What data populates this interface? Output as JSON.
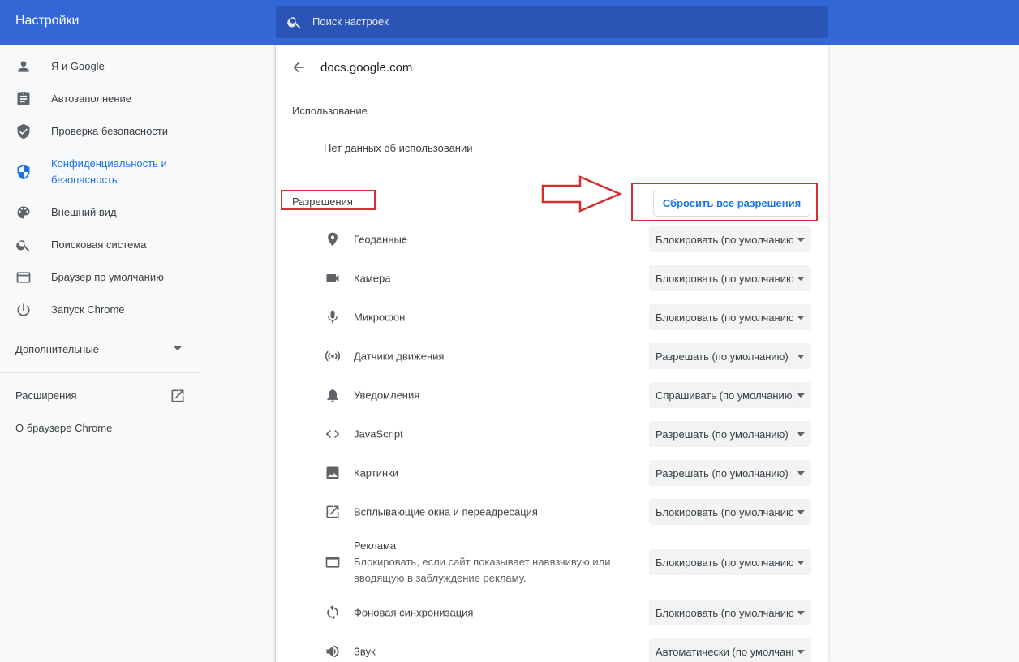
{
  "header": {
    "title": "Настройки",
    "search_placeholder": "Поиск настроек"
  },
  "sidebar": {
    "items": [
      {
        "label": "Я и Google",
        "icon": "person-icon"
      },
      {
        "label": "Автозаполнение",
        "icon": "clipboard-icon"
      },
      {
        "label": "Проверка безопасности",
        "icon": "shield-check-icon"
      },
      {
        "label": "Конфиденциальность и безопасность",
        "icon": "privacy-shield-icon",
        "active": true
      },
      {
        "label": "Внешний вид",
        "icon": "palette-icon"
      },
      {
        "label": "Поисковая система",
        "icon": "search-icon"
      },
      {
        "label": "Браузер по умолчанию",
        "icon": "browser-window-icon"
      },
      {
        "label": "Запуск Chrome",
        "icon": "power-icon"
      }
    ],
    "advanced_label": "Дополнительные",
    "extensions_label": "Расширения",
    "about_label": "О браузере Chrome"
  },
  "main": {
    "site": "docs.google.com",
    "usage_heading": "Использование",
    "usage_text": "Нет данных об использовании",
    "permissions_heading": "Разрешения",
    "reset_button": "Сбросить все разрешения",
    "permissions": [
      {
        "label": "Геоданные",
        "value": "Блокировать (по умолчанию)",
        "icon": "location-pin-icon"
      },
      {
        "label": "Камера",
        "value": "Блокировать (по умолчанию)",
        "icon": "camera-icon"
      },
      {
        "label": "Микрофон",
        "value": "Блокировать (по умолчанию)",
        "icon": "microphone-icon"
      },
      {
        "label": "Датчики движения",
        "value": "Разрешать (по умолчанию)",
        "icon": "sensors-icon"
      },
      {
        "label": "Уведомления",
        "value": "Спрашивать (по умолчанию)",
        "icon": "bell-icon"
      },
      {
        "label": "JavaScript",
        "value": "Разрешать (по умолчанию)",
        "icon": "code-icon"
      },
      {
        "label": "Картинки",
        "value": "Разрешать (по умолчанию)",
        "icon": "image-icon"
      },
      {
        "label": "Всплывающие окна и переадресация",
        "value": "Блокировать (по умолчанию)",
        "icon": "open-external-icon"
      },
      {
        "label": "Реклама",
        "sublabel": "Блокировать, если сайт показывает навязчивую или вводящую в заблуждение рекламу.",
        "value": "Блокировать (по умолчанию)",
        "icon": "ads-window-icon"
      },
      {
        "label": "Фоновая синхронизация",
        "value": "Блокировать (по умолчанию)",
        "icon": "sync-icon"
      },
      {
        "label": "Звук",
        "value": "Автоматически (по умолчанию)",
        "icon": "volume-icon"
      }
    ]
  },
  "colors": {
    "header_bg": "#3367d6",
    "accent": "#1a73e8",
    "annotation": "#d32f2f"
  }
}
